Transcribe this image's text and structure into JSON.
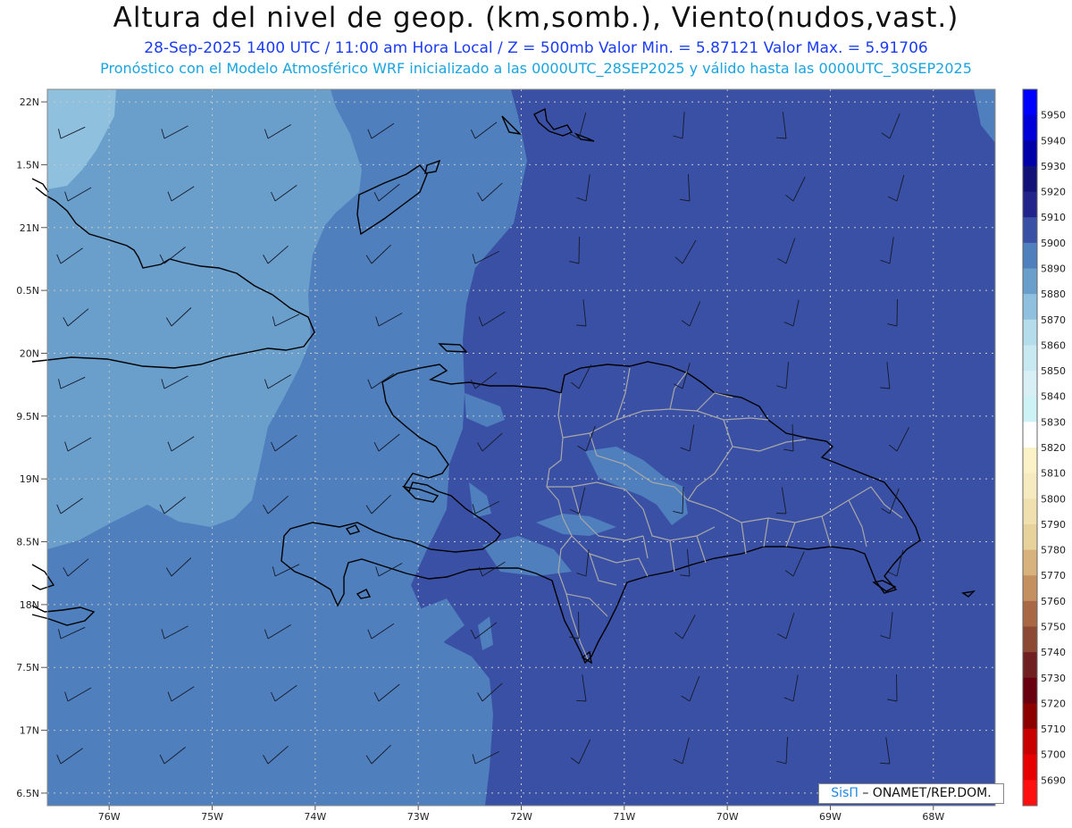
{
  "title": "Altura del nivel de geop. (km,somb.), Viento(nudos,vast.)",
  "subtitle1": "28-Sep-2025  1400 UTC / 11:00 am Hora Local / Z = 500mb    Valor Min. = 5.87121   Valor Max. = 5.91706",
  "subtitle2": "Pronóstico con el Modelo Atmosférico WRF inicializado a las 0000UTC_28SEP2025 y válido hasta las  0000UTC_30SEP2025",
  "credit": {
    "brand": "SisΠ",
    "org": " – ONAMET/REP.DOM."
  },
  "map": {
    "lon_range": [
      -76.6,
      -67.4
    ],
    "lat_range": [
      16.4,
      22.1
    ],
    "lon_ticks": [
      {
        "value": -76,
        "label": "76W"
      },
      {
        "value": -75,
        "label": "75W"
      },
      {
        "value": -74,
        "label": "74W"
      },
      {
        "value": -73,
        "label": "73W"
      },
      {
        "value": -72,
        "label": "72W"
      },
      {
        "value": -71,
        "label": "71W"
      },
      {
        "value": -70,
        "label": "70W"
      },
      {
        "value": -69,
        "label": "69W"
      },
      {
        "value": -68,
        "label": "68W"
      }
    ],
    "lat_ticks": [
      {
        "value": 22,
        "label": "22N"
      },
      {
        "value": 21.5,
        "label": "1.5N"
      },
      {
        "value": 21,
        "label": "21N"
      },
      {
        "value": 20.5,
        "label": "0.5N"
      },
      {
        "value": 20,
        "label": "20N"
      },
      {
        "value": 19.5,
        "label": "9.5N"
      },
      {
        "value": 19,
        "label": "19N"
      },
      {
        "value": 18.5,
        "label": "8.5N"
      },
      {
        "value": 18,
        "label": "18N"
      },
      {
        "value": 17.5,
        "label": "7.5N"
      },
      {
        "value": 17,
        "label": "17N"
      },
      {
        "value": 16.5,
        "label": "6.5N"
      }
    ],
    "geopotential_field": {
      "west_zone_level": 5890,
      "east_zone_level": 5900,
      "northwest_corner_level": 5880,
      "boundary_approx_lon": -72.6
    }
  },
  "colorbar": {
    "levels": [
      {
        "value": 5950,
        "label": "5950",
        "color": "#0000ff"
      },
      {
        "value": 5940,
        "label": "5940",
        "color": "#0000d8"
      },
      {
        "value": 5930,
        "label": "5930",
        "color": "#0000a8"
      },
      {
        "value": 5920,
        "label": "5920",
        "color": "#111178"
      },
      {
        "value": 5910,
        "label": "5910",
        "color": "#23238c"
      },
      {
        "value": 5900,
        "label": "5900",
        "color": "#3a50a4"
      },
      {
        "value": 5890,
        "label": "5890",
        "color": "#4f7fbc"
      },
      {
        "value": 5880,
        "label": "5880",
        "color": "#6a9ecb"
      },
      {
        "value": 5870,
        "label": "5870",
        "color": "#8fc0dd"
      },
      {
        "value": 5860,
        "label": "5860",
        "color": "#b4dcea"
      },
      {
        "value": 5850,
        "label": "5850",
        "color": "#c8e8f2"
      },
      {
        "value": 5840,
        "label": "5840",
        "color": "#d8eff6"
      },
      {
        "value": 5830,
        "label": "5830",
        "color": "#cdf3f6"
      },
      {
        "value": 5820,
        "label": "5820",
        "color": "#ffffff"
      },
      {
        "value": 5810,
        "label": "5810",
        "color": "#fbf2c8"
      },
      {
        "value": 5800,
        "label": "5800",
        "color": "#f6ebc0"
      },
      {
        "value": 5790,
        "label": "5790",
        "color": "#f0e0b0"
      },
      {
        "value": 5780,
        "label": "5780",
        "color": "#e8d29c"
      },
      {
        "value": 5770,
        "label": "5770",
        "color": "#d8b27c"
      },
      {
        "value": 5760,
        "label": "5760",
        "color": "#c49060"
      },
      {
        "value": 5750,
        "label": "5750",
        "color": "#a86844"
      },
      {
        "value": 5740,
        "label": "5740",
        "color": "#8c4a34"
      },
      {
        "value": 5730,
        "label": "5730",
        "color": "#702020"
      },
      {
        "value": 5720,
        "label": "5720",
        "color": "#680010"
      },
      {
        "value": 5710,
        "label": "5710",
        "color": "#8c0000"
      },
      {
        "value": 5700,
        "label": "5700",
        "color": "#c80000"
      },
      {
        "value": 5690,
        "label": "5690",
        "color": "#e60000"
      },
      {
        "value": "",
        "label": "",
        "color": "#ff1010"
      }
    ]
  },
  "colors": {
    "coastline": "#000000",
    "provinces": "#a8a8a8",
    "barbs": "#151a2a",
    "grid": "#c8c8c8"
  }
}
